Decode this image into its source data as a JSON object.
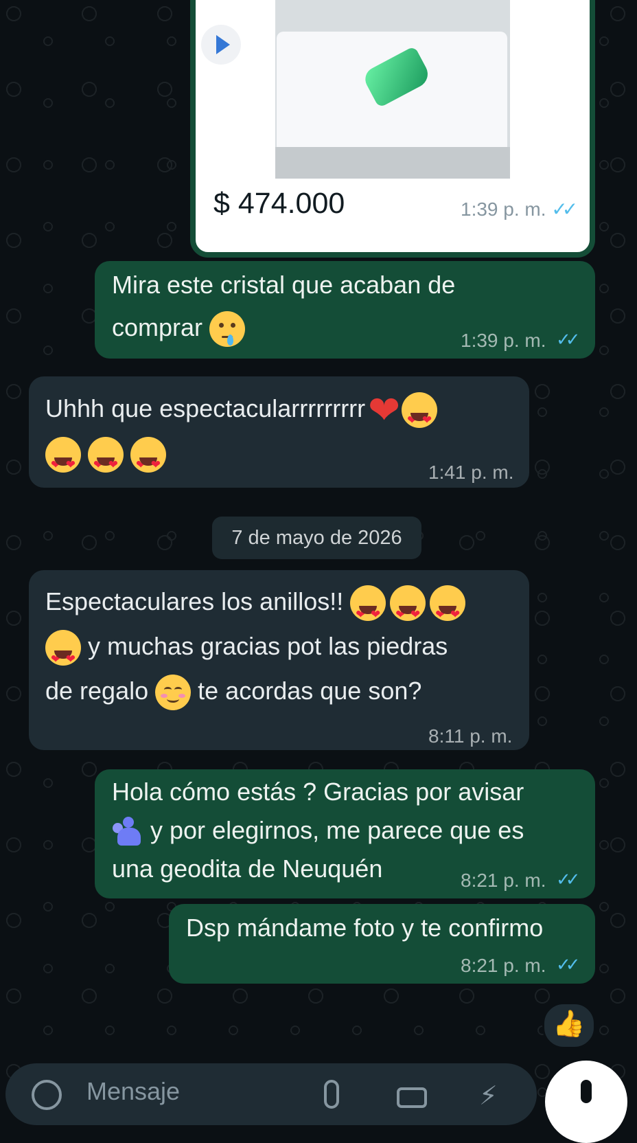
{
  "media_message": {
    "price": "$ 474.000",
    "time": "1:39 p. m.",
    "image_desc_icon": "play-icon"
  },
  "messages": [
    {
      "id": "m1",
      "lines": [
        "Mira este cristal que acaban de",
        "comprar"
      ],
      "time": "1:39 p. m."
    },
    {
      "id": "m2",
      "lines": [
        "Uhhh que espectacularrrrrrrrr"
      ],
      "time": "1:41 p. m."
    },
    {
      "id": "m3",
      "lines": [
        "Espectaculares los anillos!!",
        "y muchas gracias pot las piedras",
        "de regalo",
        "te acordas que son?"
      ],
      "time": "8:11 p. m."
    },
    {
      "id": "m4",
      "lines": [
        "Hola cómo estás ? Gracias por avisar",
        "y por elegirnos, me parece que es",
        "una geodita de Neuquén"
      ],
      "time": "8:21 p. m."
    },
    {
      "id": "m5",
      "lines": [
        "Dsp mándame foto y te confirmo"
      ],
      "time": "8:21 p. m."
    }
  ],
  "date_separator": "7 de mayo de 2026",
  "reaction": "👍",
  "composer": {
    "placeholder": "Mensaje"
  },
  "colors": {
    "background": "#0b1014",
    "outgoing": "#144d37",
    "incoming": "#1f2c34",
    "read_ticks": "#53bdeb"
  }
}
